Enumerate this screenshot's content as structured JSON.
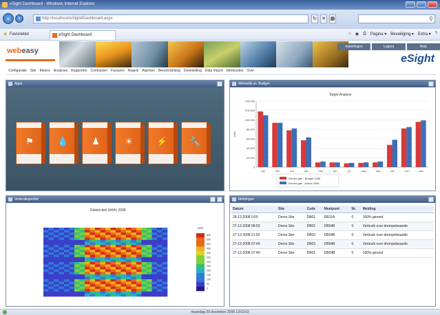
{
  "browser": {
    "title": "eSight Dashboard - Windows Internet Explorer",
    "url": "http://localhost/eSight/Dashboard.aspx",
    "favorites_label": "Favorieten",
    "tab_label": "eSight Dashboard",
    "commands": [
      "Pagina ▾",
      "Beveiliging ▾",
      "Extra ▾"
    ]
  },
  "header": {
    "logo_web": "web",
    "logo_easy": "easy",
    "brand": "eSight",
    "links": [
      "Instellingen",
      "Logout",
      "Help"
    ]
  },
  "menu": [
    "Configuratie",
    "Site",
    "Meters",
    "Analyses",
    "Rapporten",
    "Contracten",
    "Facturen",
    "Regels",
    "Alarmen",
    "Benchmarking",
    "Doelstelling",
    "Data Import",
    "Meetcodes",
    "Over"
  ],
  "panels": {
    "apps": {
      "title": "Apps",
      "boxes": [
        {
          "icon": "flame-icon",
          "glyph": "⚑"
        },
        {
          "icon": "drop-icon",
          "glyph": "💧"
        },
        {
          "icon": "person-icon",
          "glyph": "♟"
        },
        {
          "icon": "sun-icon",
          "glyph": "☀"
        },
        {
          "icon": "lightning-icon",
          "glyph": "⚡"
        },
        {
          "icon": "wrench-icon",
          "glyph": "🔧"
        }
      ]
    },
    "chart": {
      "title": "Werkelijk vs. Budget"
    },
    "heatmap": {
      "title": "Verbruiksprofiel",
      "chart_title": "Elektriciteit (kWh) 2008",
      "legend_label": "kWh",
      "legend_ticks": [
        "600",
        "550",
        "500",
        "450",
        "400",
        "350",
        "300",
        "250",
        "200",
        "150",
        "100",
        "50",
        "0"
      ]
    },
    "table": {
      "title": "Meldingen",
      "headers": [
        "Datum",
        "Site",
        "Code",
        "Meetpunt",
        "Nr.",
        "Melding"
      ],
      "rows": [
        {
          "date": "28-12-2008 0:00",
          "site": "Demo Site",
          "code": "DB01",
          "meter": "DB11A",
          "nr": "0",
          "msg": "100% gereed"
        },
        {
          "date": "27-12-2008 08:59",
          "site": "Demo Site",
          "code": "DB02",
          "meter": "DB04B",
          "nr": "0",
          "msg": "Verbruik over drempelwaarde"
        },
        {
          "date": "27-12-2008 21:50",
          "site": "Demo Site",
          "code": "DB03",
          "meter": "DB04B",
          "nr": "0",
          "msg": "Verbruik over drempelwaarde"
        },
        {
          "date": "27-12-2008 07:49",
          "site": "Demo Site",
          "code": "DB03",
          "meter": "DB04B",
          "nr": "0",
          "msg": "Verbruik over drempelwaarde"
        },
        {
          "date": "27-12-2008 07:49",
          "site": "Demo Site",
          "code": "DB01",
          "meter": "DB04B",
          "nr": "0",
          "msg": "100% gereed"
        }
      ]
    }
  },
  "status_text": "maandag 29 december 2008 13:03:02",
  "colors": {
    "budget": "#d83a3a",
    "actual": "#3d6fb6",
    "accent": "#e86a1c"
  },
  "chart_data": [
    {
      "type": "bar",
      "title": "Target Analyse",
      "categories": [
        "jan",
        "feb",
        "mrt",
        "apr",
        "mei",
        "jun",
        "jul",
        "aug",
        "sep",
        "okt",
        "nov",
        "dec"
      ],
      "ylim": [
        0,
        140000
      ],
      "yticks": [
        "140,000",
        "120,000",
        "100,000",
        "80,000",
        "60,000",
        "40,000",
        "20,000",
        "0"
      ],
      "ylabel": "kWh",
      "series": [
        {
          "name": "Electra gas - Budget 2008",
          "values": [
            118000,
            94000,
            78000,
            57000,
            10000,
            10000,
            8000,
            9000,
            10000,
            47000,
            82000,
            96000
          ]
        },
        {
          "name": "Electra gas - Actual 2008",
          "values": [
            110000,
            94000,
            82000,
            63000,
            12000,
            10000,
            9000,
            10000,
            12000,
            58000,
            85000,
            99000
          ]
        }
      ],
      "legend": "bottom"
    },
    {
      "type": "heatmap",
      "title": "Elektriciteit (kWh) 2008",
      "legend": "right"
    }
  ]
}
